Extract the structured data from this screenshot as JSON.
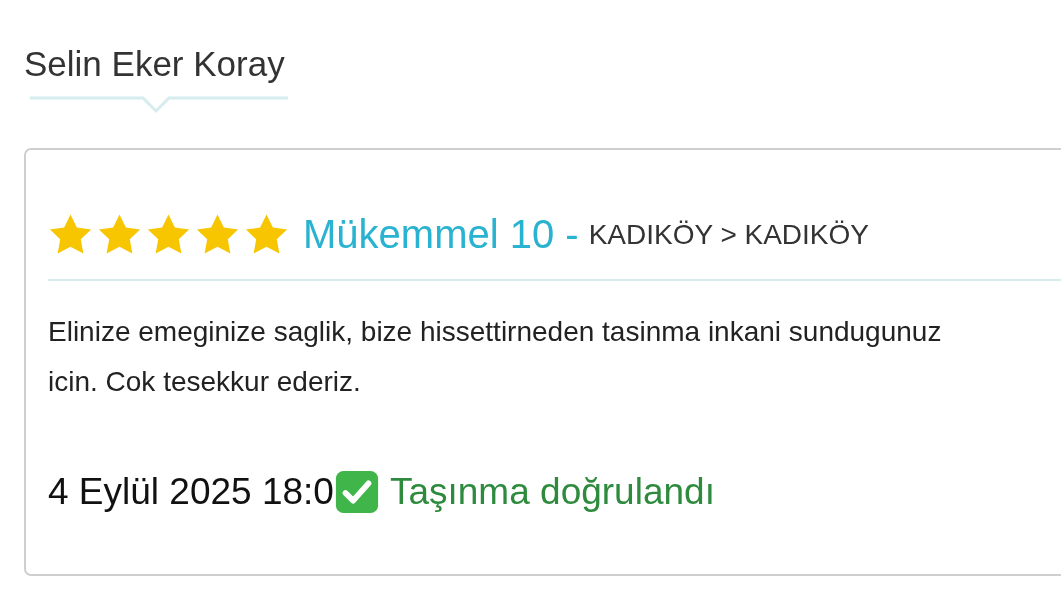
{
  "reviewer": {
    "name": "Selin Eker Koray"
  },
  "review": {
    "stars": 5,
    "rating": "Mükemmel 10 -",
    "route": "KADIKÖY > KADIKÖY",
    "text": "Elinize emeginize saglik, bize hissettirneden tasinma inkani sundugunuz icin. Cok tesekkur ederiz.",
    "date": "4 Eylül 2025 18:0",
    "verified": true,
    "verified_label": "Taşınma doğrulandı"
  }
}
